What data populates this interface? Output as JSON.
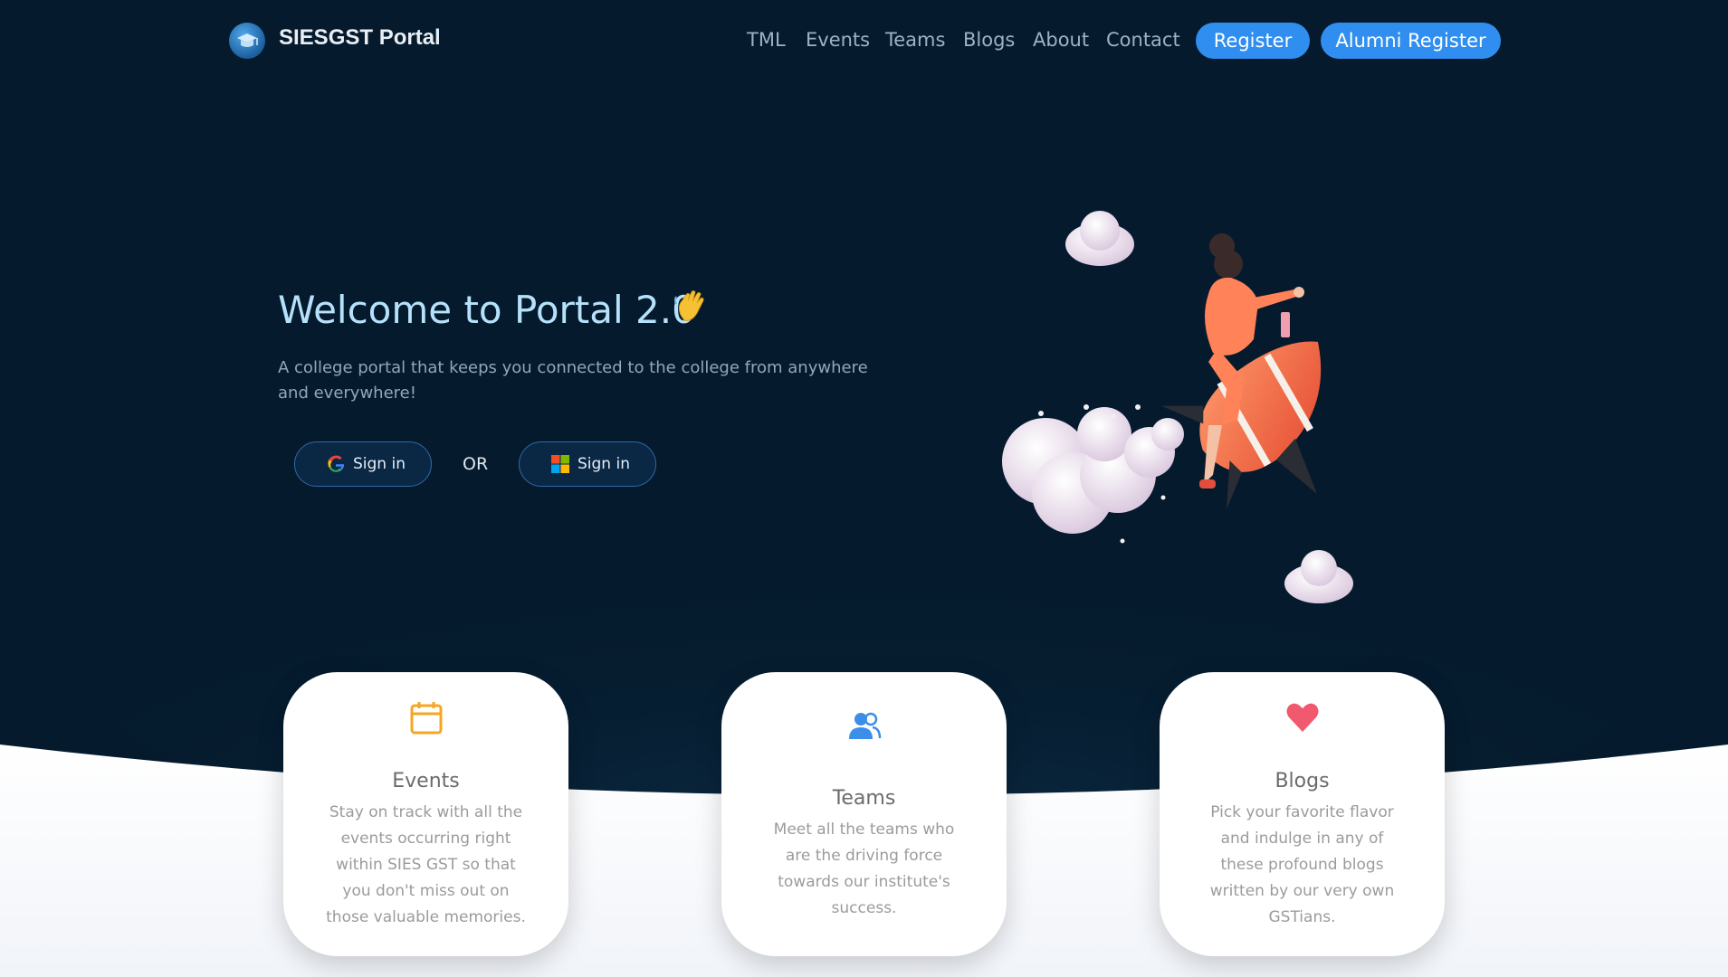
{
  "nav": {
    "brand": "SIESGST Portal",
    "links": [
      "TML",
      "Events",
      "Teams",
      "Blogs",
      "About",
      "Contact"
    ],
    "register_label": "Register",
    "alumni_register_label": "Alumni Register"
  },
  "hero": {
    "title": "Welcome to Portal 2.0",
    "subtitle": "A college portal that keeps you connected to the college from anywhere and everywhere!",
    "google_signin_label": "Sign in",
    "or_label": "OR",
    "microsoft_signin_label": "Sign in"
  },
  "cards": [
    {
      "title": "Events",
      "description": "Stay on track with all the events occurring right within SIES GST so that you don't miss out on those valuable memories.",
      "icon": "calendar-icon",
      "color": "#f5a623"
    },
    {
      "title": "Teams",
      "description": "Meet all the teams who are the driving force towards our institute's success.",
      "icon": "users-icon",
      "color": "#3b8fe8"
    },
    {
      "title": "Blogs",
      "description": "Pick your favorite flavor and indulge in any of these profound blogs written by our very own GSTians.",
      "icon": "heart-icon",
      "color": "#f15a6e"
    }
  ],
  "colors": {
    "background": "#051b2d",
    "accent": "#2f8ef0",
    "title": "#b6e1fb"
  }
}
